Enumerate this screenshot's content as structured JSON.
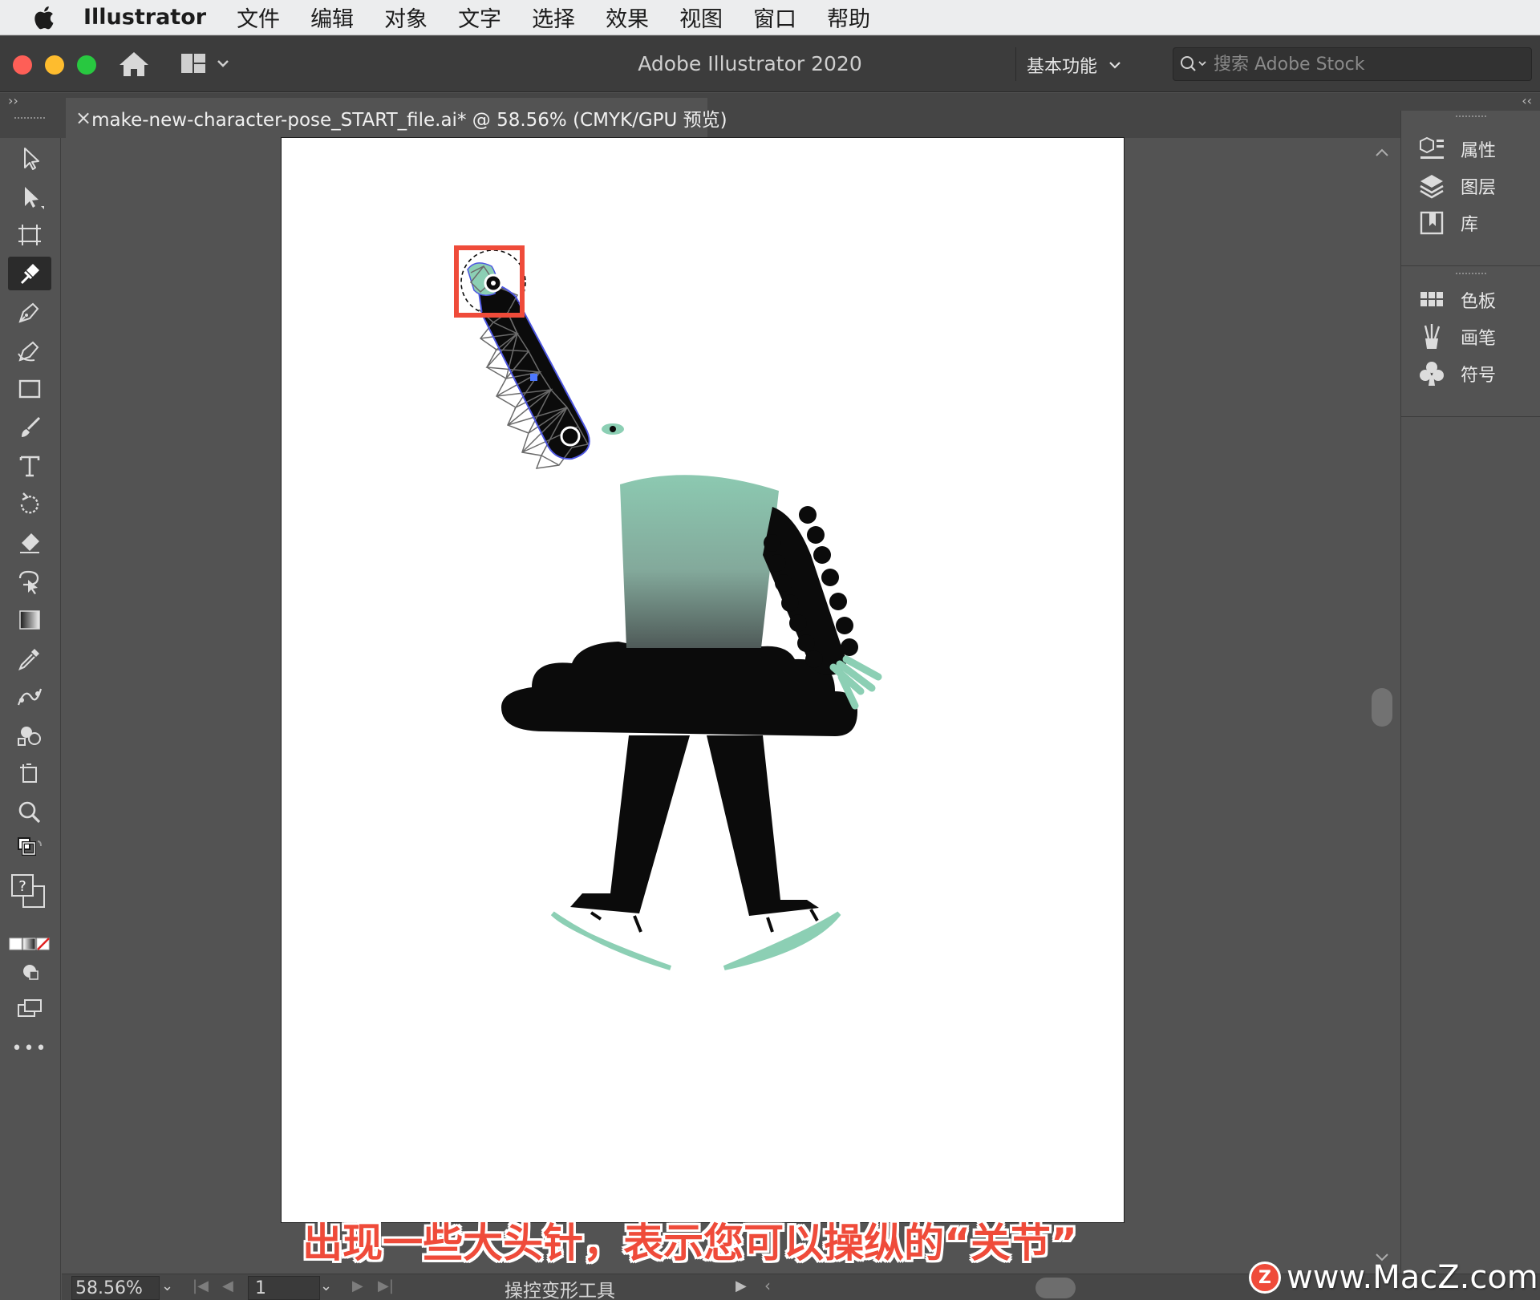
{
  "menubar": {
    "app_name": "Illustrator",
    "items": [
      "文件",
      "编辑",
      "对象",
      "文字",
      "选择",
      "效果",
      "视图",
      "窗口",
      "帮助"
    ]
  },
  "titlebar": {
    "title": "Adobe Illustrator 2020",
    "workspace": "基本功能",
    "search_placeholder": "搜索 Adobe Stock"
  },
  "tabbar": {
    "left_collapse": "››",
    "right_collapse": "‹‹",
    "close_label": "×",
    "document_title": "make-new-character-pose_START_file.ai* @ 58.56% (CMYK/GPU 预览)"
  },
  "toolbar": {
    "active_tool": "puppet-warp",
    "tools": [
      "selection",
      "direct-selection",
      "artboard",
      "puppet-warp",
      "pen",
      "curvature",
      "rectangle",
      "paintbrush",
      "type",
      "rotate",
      "eraser",
      "free-transform",
      "gradient",
      "eyedropper",
      "blend",
      "shape-builder",
      "artboard-crop",
      "zoom",
      "fill-stroke",
      "color-modes",
      "draw-mode",
      "screen-mode",
      "more"
    ],
    "more_label": "•••",
    "unknown_label": "?"
  },
  "right_panel": {
    "group1": [
      {
        "icon": "properties-icon",
        "label": "属性"
      },
      {
        "icon": "layers-icon",
        "label": "图层"
      },
      {
        "icon": "libraries-icon",
        "label": "库"
      }
    ],
    "group2": [
      {
        "icon": "swatches-icon",
        "label": "色板"
      },
      {
        "icon": "brushes-icon",
        "label": "画笔"
      },
      {
        "icon": "symbols-icon",
        "label": "符号"
      }
    ]
  },
  "statusbar": {
    "zoom": "58.56%",
    "page": "1",
    "tool_name": "操控变形工具"
  },
  "colors": {
    "accent_red": "#ef4b3a",
    "mint": "#8ccfb4",
    "ink": "#0b0b0b",
    "ui_dark": "#535353"
  },
  "subtitle": "出现一些大头针，表示您可以操纵的“关节”",
  "watermark": {
    "text": "www.MacZ.com",
    "logo": "Z"
  }
}
